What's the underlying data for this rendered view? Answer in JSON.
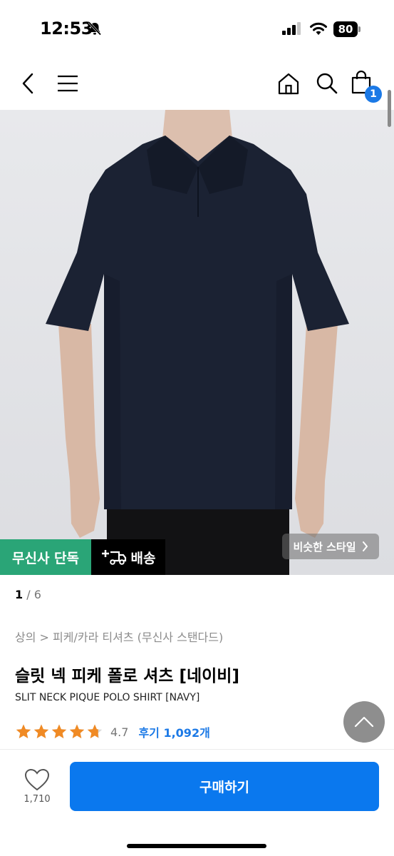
{
  "status_bar": {
    "time": "12:53",
    "battery": "80",
    "icons": [
      "bell-slash-icon",
      "cellular-signal-icon",
      "wifi-icon",
      "battery-icon"
    ]
  },
  "nav": {
    "icons": [
      "chevron-left-icon",
      "hamburger-menu-icon",
      "home-icon",
      "search-icon",
      "shopping-bag-icon"
    ],
    "cart_count": "1"
  },
  "image": {
    "exclusive_badge": "무신사 단독",
    "delivery_badge": "배송",
    "similar_style": "비슷한 스타일",
    "counter_current": "1",
    "counter_total": " / 6"
  },
  "product": {
    "breadcrumb": "상의 > 피케/카라 티셔츠 (무신사 스탠다드)",
    "title": "슬릿 넥 피케 폴로 셔츠 [네이비]",
    "subtitle": "SLIT NECK PIQUE POLO SHIRT [NAVY]",
    "rating": "4.7",
    "rating_value": 4.7,
    "reviews": "후기 1,092개"
  },
  "bottom": {
    "like_count": "1,710",
    "buy_label": "구매하기"
  },
  "colors": {
    "accent_blue": "#0a78ee",
    "exclusive_green": "#2aa577",
    "star_orange": "#f08a24",
    "shirt_navy": "#1b2233"
  }
}
